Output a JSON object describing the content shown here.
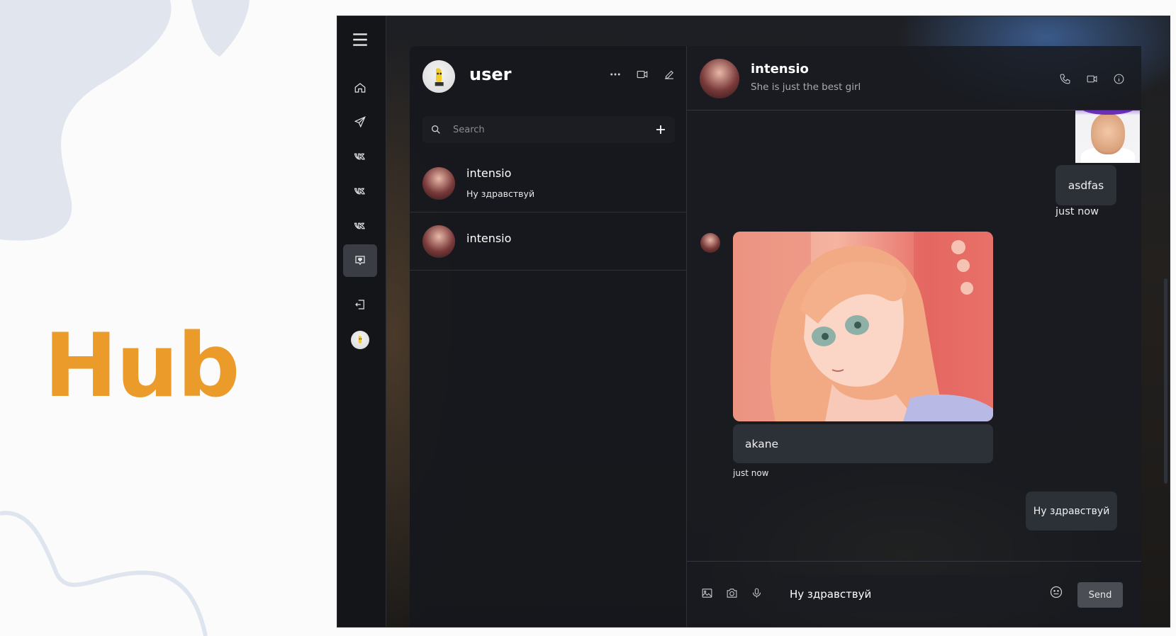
{
  "brand": {
    "title": "Hub"
  },
  "sidebar": {
    "items": [
      {
        "icon": "menu-icon"
      },
      {
        "icon": "home-icon"
      },
      {
        "icon": "send-icon"
      },
      {
        "icon": "vk-icon"
      },
      {
        "icon": "vk-icon"
      },
      {
        "icon": "vk-icon"
      },
      {
        "icon": "message-heart-icon",
        "active": true
      },
      {
        "icon": "logout-icon"
      },
      {
        "icon": "avatar"
      }
    ]
  },
  "contacts": {
    "user_name": "user",
    "search_placeholder": "Search",
    "chats": [
      {
        "name": "intensio",
        "preview": "Ну здравствуй"
      },
      {
        "name": "intensio",
        "preview": ""
      }
    ]
  },
  "conversation": {
    "name": "intensio",
    "status": "She is just the best girl",
    "messages": [
      {
        "direction": "out",
        "type": "image",
        "image": "man-photo"
      },
      {
        "direction": "out",
        "type": "text",
        "text": "asdfas",
        "time": "just now"
      },
      {
        "direction": "in",
        "type": "image",
        "image": "anime-girl-illustration"
      },
      {
        "direction": "in",
        "type": "text",
        "text": "akane",
        "time": "just now"
      },
      {
        "direction": "out",
        "type": "text",
        "text": "Ну здравствуй"
      }
    ],
    "composer": {
      "value": "Ну здравствуй",
      "send_label": "Send"
    }
  },
  "colors": {
    "brand": "#eb9b2a",
    "window_bg": "#1b1d22",
    "bubble": "#2e323a",
    "send_button": "#4a4d53"
  }
}
